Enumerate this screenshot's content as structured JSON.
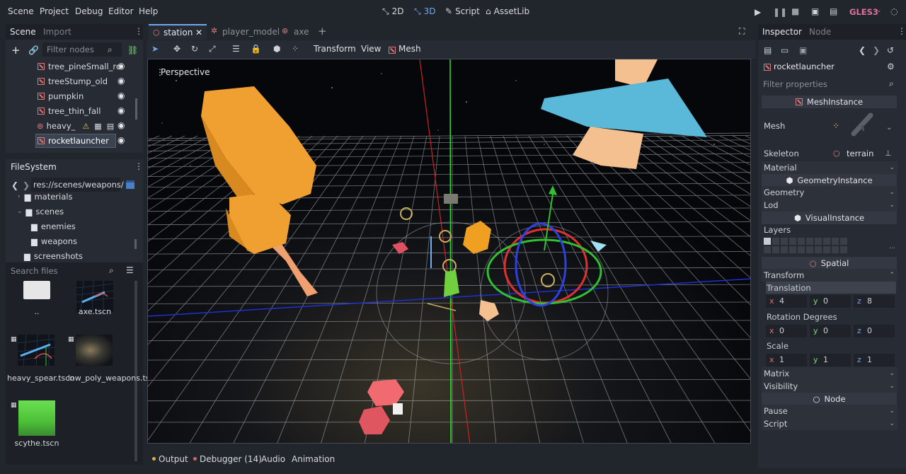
{
  "menubar": {
    "items": [
      "Scene",
      "Project",
      "Debug",
      "Editor",
      "Help"
    ],
    "workspaces": [
      "2D",
      "3D",
      "Script",
      "AssetLib"
    ],
    "renderer": "GLES3"
  },
  "scene_dock": {
    "tabs": [
      "Scene",
      "Import"
    ],
    "filter_placeholder": "Filter nodes",
    "nodes": [
      "tree_pineSmall_ro",
      "treeStump_old",
      "pumpkin",
      "tree_thin_fall",
      "heavy_",
      "rocketlauncher"
    ]
  },
  "filesystem": {
    "title": "FileSystem",
    "path": "res://scenes/weapons/",
    "tree": [
      "materials",
      "scenes",
      "enemies",
      "weapons",
      "screenshots"
    ],
    "search_placeholder": "Search files",
    "files": [
      {
        "name": ".."
      },
      {
        "name": "axe.tscn"
      },
      {
        "name": "heavy_spear.tscn"
      },
      {
        "name": "low_poly_weapons.tscn"
      },
      {
        "name": "scythe.tscn"
      }
    ]
  },
  "editor": {
    "tabs": [
      "station",
      "player_model",
      "axe"
    ],
    "toolbar": {
      "transform": "Transform",
      "view": "View",
      "mesh": "Mesh"
    },
    "viewport_label": "Perspective"
  },
  "bottom_tabs": [
    "Output",
    "Debugger (14)",
    "Audio",
    "Animation"
  ],
  "inspector": {
    "tabs": [
      "Inspector",
      "Node"
    ],
    "object": "rocketlauncher",
    "filter_placeholder": "Filter properties",
    "sections": {
      "mesh_instance": "MeshInstance",
      "geometry_instance": "GeometryInstance",
      "visual_instance": "VisualInstance",
      "spatial": "Spatial",
      "node": "Node"
    },
    "props": {
      "mesh": "Mesh",
      "skeleton": "Skeleton",
      "skeleton_value": "terrain",
      "material": "Material",
      "geometry": "Geometry",
      "lod": "Lod",
      "layers": "Layers",
      "transform": "Transform",
      "translation": "Translation",
      "rotation": "Rotation Degrees",
      "scale": "Scale",
      "matrix": "Matrix",
      "visibility": "Visibility",
      "pause": "Pause",
      "script": "Script"
    },
    "translation": {
      "x": "4",
      "y": "0",
      "z": "8"
    },
    "rotation_degrees": {
      "x": "0",
      "y": "0",
      "z": "0"
    },
    "scale": {
      "x": "1",
      "y": "1",
      "z": "1"
    },
    "axis_labels": {
      "x": "x",
      "y": "y",
      "z": "z"
    }
  },
  "colors": {
    "accent": "#6fa8ec",
    "bg": "#21252c",
    "panel": "#272b33",
    "selected": "#3b4250",
    "axis_x": "#e07070",
    "axis_y": "#7ee07a",
    "axis_z": "#7a9ef0"
  }
}
